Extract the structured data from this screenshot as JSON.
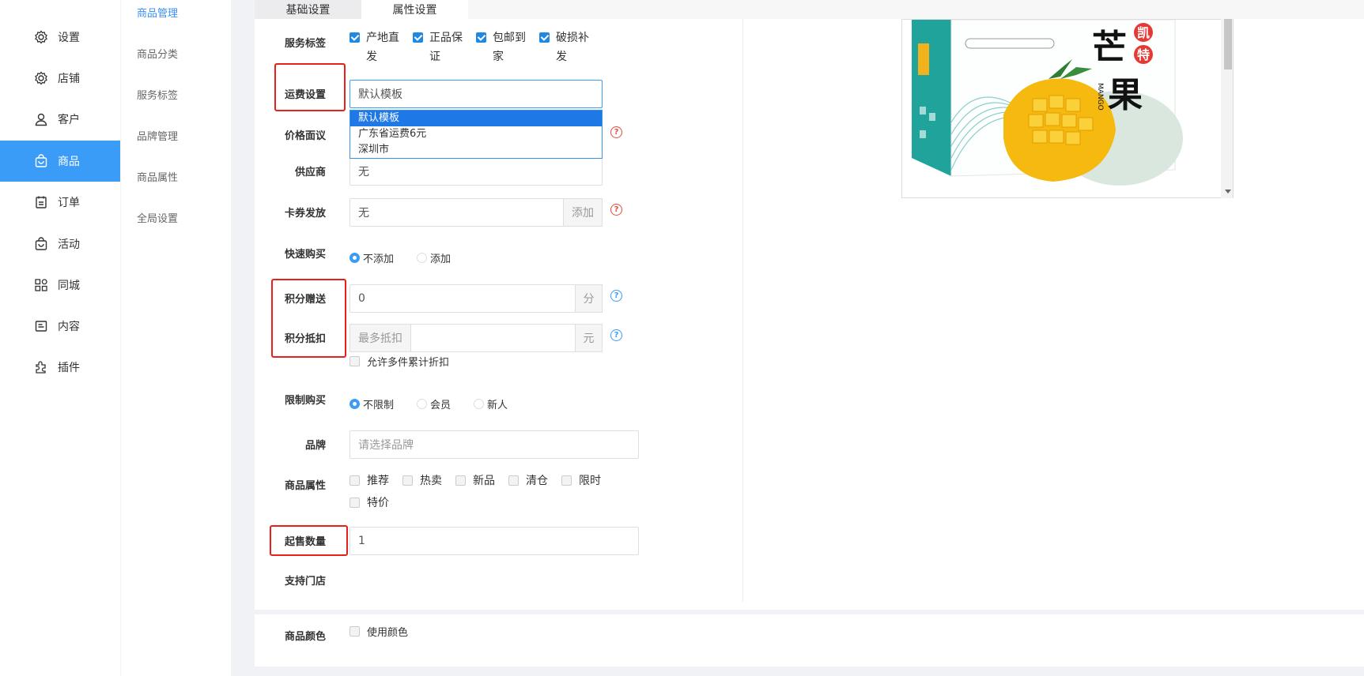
{
  "sidebar": {
    "items": [
      {
        "label": "设置",
        "icon": "gear-icon"
      },
      {
        "label": "店铺",
        "icon": "gear-icon"
      },
      {
        "label": "客户",
        "icon": "user-icon"
      },
      {
        "label": "商品",
        "icon": "bag-icon"
      },
      {
        "label": "订单",
        "icon": "clipboard-icon"
      },
      {
        "label": "活动",
        "icon": "bag-icon"
      },
      {
        "label": "同城",
        "icon": "grid-icon"
      },
      {
        "label": "内容",
        "icon": "document-icon"
      },
      {
        "label": "插件",
        "icon": "puzzle-icon"
      }
    ],
    "active": "商品",
    "active_color": "#3b9cf8"
  },
  "subnav": {
    "items": [
      "商品管理",
      "商品分类",
      "服务标签",
      "品牌管理",
      "商品属性",
      "全局设置"
    ],
    "active": "商品管理"
  },
  "tabs": [
    "基础设置",
    "属性设置"
  ],
  "form": {
    "service_tags": {
      "label": "服务标签",
      "options": [
        "产地直发",
        "正品保证",
        "包邮到家",
        "破损补发"
      ],
      "options_line1": [
        "产地直",
        "正品保",
        "包邮到",
        "破损补"
      ],
      "options_line2": [
        "发",
        "证",
        "家",
        "发"
      ]
    },
    "shipping": {
      "label": "运费设置",
      "value": "默认模板",
      "options": [
        "默认模板",
        "广东省运费6元",
        "深圳市"
      ]
    },
    "price_negotiable": {
      "label": "价格面议"
    },
    "supplier": {
      "label": "供应商",
      "value": "无"
    },
    "coupon": {
      "label": "卡券发放",
      "value": "无",
      "addon": "添加"
    },
    "quick_buy": {
      "label": "快速购买",
      "options": [
        "不添加",
        "添加"
      ],
      "selected": "不添加"
    },
    "points_gift": {
      "label": "积分赠送",
      "value": "0",
      "unit": "分"
    },
    "points_deduct": {
      "label": "积分抵扣",
      "prefix": "最多抵扣",
      "unit": "元",
      "checkbox": "允许多件累计折扣"
    },
    "purchase_limit": {
      "label": "限制购买",
      "options": [
        "不限制",
        "会员",
        "新人"
      ],
      "selected": "不限制"
    },
    "brand": {
      "label": "品牌",
      "placeholder": "请选择品牌"
    },
    "attributes": {
      "label": "商品属性",
      "options": [
        "推荐",
        "热卖",
        "新品",
        "清仓",
        "限时",
        "特价"
      ]
    },
    "min_qty": {
      "label": "起售数量",
      "value": "1"
    },
    "stores": {
      "label": "支持门店"
    },
    "color": {
      "label": "商品颜色",
      "checkbox": "使用颜色"
    }
  },
  "help_icon": "?",
  "product_image": {
    "brand_chars": [
      "凯",
      "特"
    ],
    "title_chars": [
      "芒",
      "果"
    ],
    "side_text": "MANGO"
  }
}
